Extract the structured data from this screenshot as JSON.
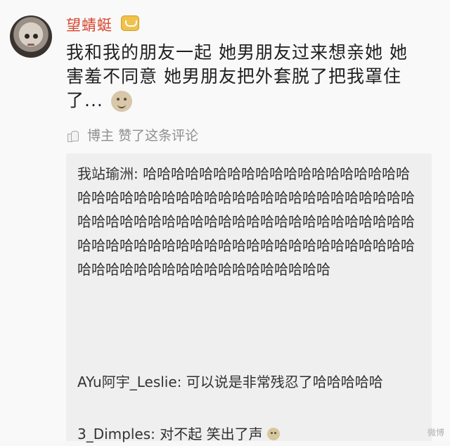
{
  "post": {
    "username": "望蜻蜓",
    "comment": "我和我的朋友一起 她男朋友过来想亲她 她害羞不同意 她男朋友把外套脱了把我罩住了...",
    "like_text": "博主 赞了这条评论"
  },
  "replies": [
    {
      "author": "我站瑜洲:",
      "text": " 哈哈哈哈哈哈哈哈哈哈哈哈哈哈哈哈哈哈哈哈哈哈哈哈哈哈哈哈哈哈哈哈哈哈哈哈哈哈哈哈哈哈哈哈哈哈哈哈哈哈哈哈哈哈哈哈哈哈哈哈哈哈哈哈哈哈哈哈哈哈哈哈哈哈哈哈哈哈哈哈哈哈哈哈哈哈哈哈哈哈哈哈哈哈哈哈哈哈哈哈哈哈哈哈哈哈哈哈哈"
    },
    {
      "author": "AYu阿宇_Leslie:",
      "text": " 可以说是非常残忍了哈哈哈哈哈"
    },
    {
      "author": "3_Dimples:",
      "text": " 对不起 笑出了声"
    }
  ],
  "watermark": "微博"
}
